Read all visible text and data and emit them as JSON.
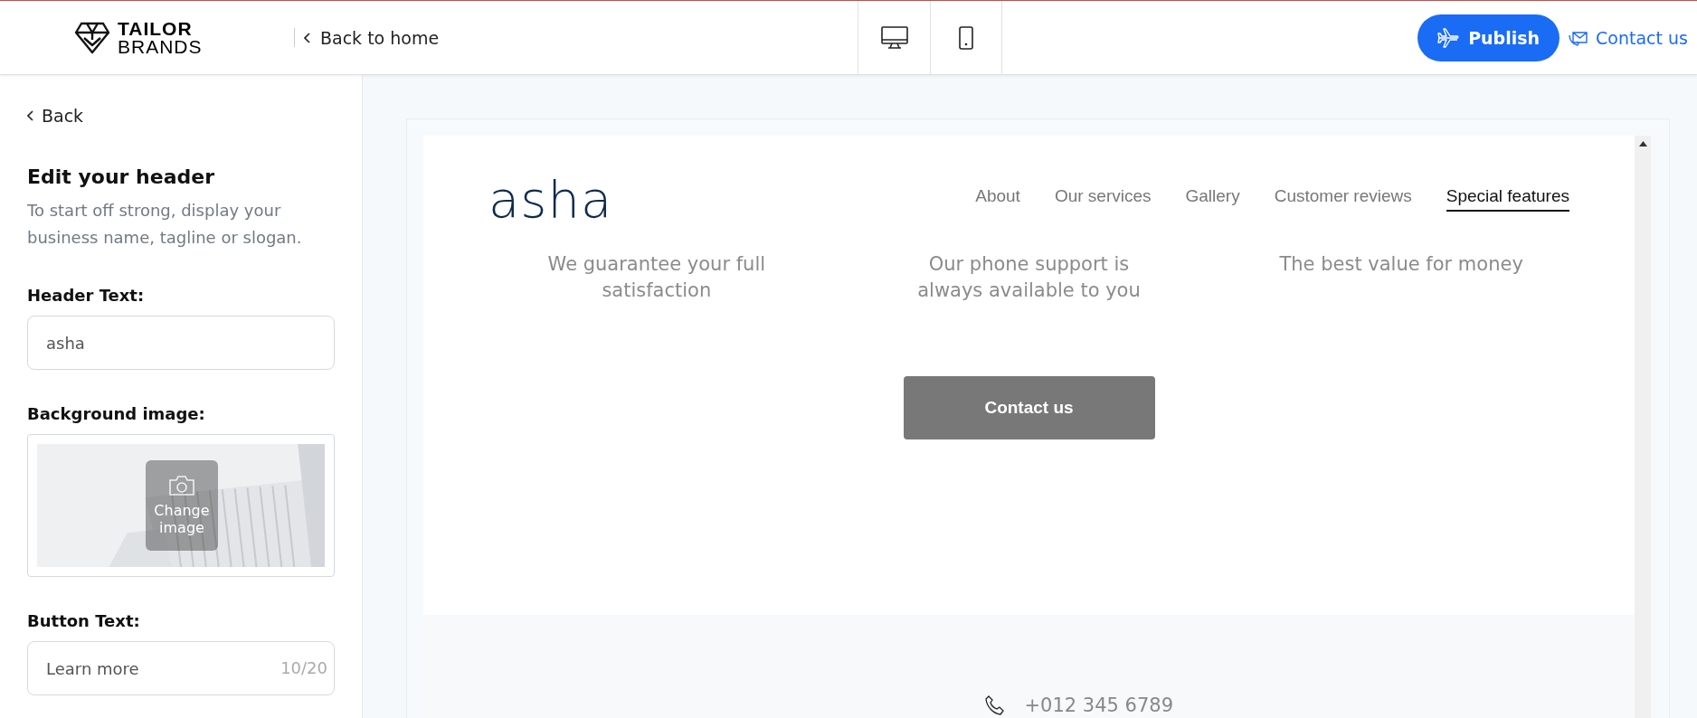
{
  "top_bar": {
    "logo": {
      "line_1": "TAILOR",
      "line_2": "BRANDS"
    },
    "back_link": "Back to home",
    "device_toggles": [
      {
        "kind": "desktop",
        "selected": false
      },
      {
        "kind": "mobile",
        "selected": false
      }
    ],
    "publish_button": "Publish",
    "contact_link": "Contact us"
  },
  "sidebar": {
    "back": "Back",
    "title": "Edit your header",
    "description": "To start off strong, display your business name, tagline or slogan.",
    "fields": [
      {
        "kind": "text",
        "label": "Header Text:",
        "value": "asha"
      },
      {
        "label": "Background image:",
        "overlay": "Change image"
      },
      {
        "kind": "text",
        "label": "Button Text:",
        "value": "Learn more",
        "counter": "10/20"
      }
    ]
  },
  "preview": {
    "site_name": "asha",
    "nav": [
      {
        "label": "About",
        "selected": false
      },
      {
        "label": "Our services",
        "selected": false
      },
      {
        "label": "Gallery",
        "selected": false
      },
      {
        "label": "Customer reviews",
        "selected": false
      },
      {
        "label": "Special features",
        "selected": true
      }
    ],
    "features": [
      "We guarantee your full satisfaction",
      "Our phone support is always available to you",
      "The best value for money"
    ],
    "cta_button": "Contact us",
    "footer_phone": "+012 345 6789"
  }
}
